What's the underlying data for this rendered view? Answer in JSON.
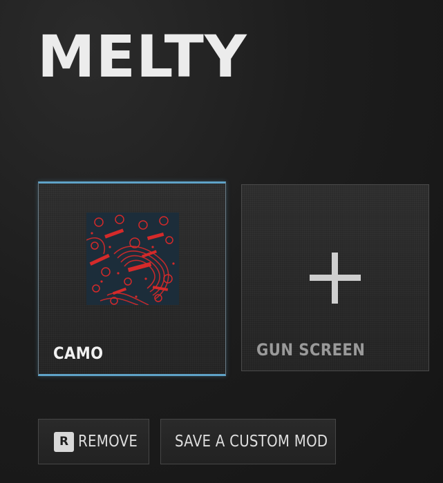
{
  "title": "MELTY",
  "cards": {
    "camo": {
      "label": "CAMO",
      "swatch": {
        "base_color": "#1c2d3a",
        "pattern_color": "#d42a2a"
      }
    },
    "gun_screen": {
      "label": "GUN SCREEN",
      "icon": "plus-icon"
    }
  },
  "buttons": {
    "remove": {
      "key": "R",
      "label": "REMOVE"
    },
    "save_custom_mod": {
      "label": "SAVE A CUSTOM MOD"
    }
  },
  "colors": {
    "selection_accent": "#5fa3c8",
    "title": "#ececec"
  }
}
